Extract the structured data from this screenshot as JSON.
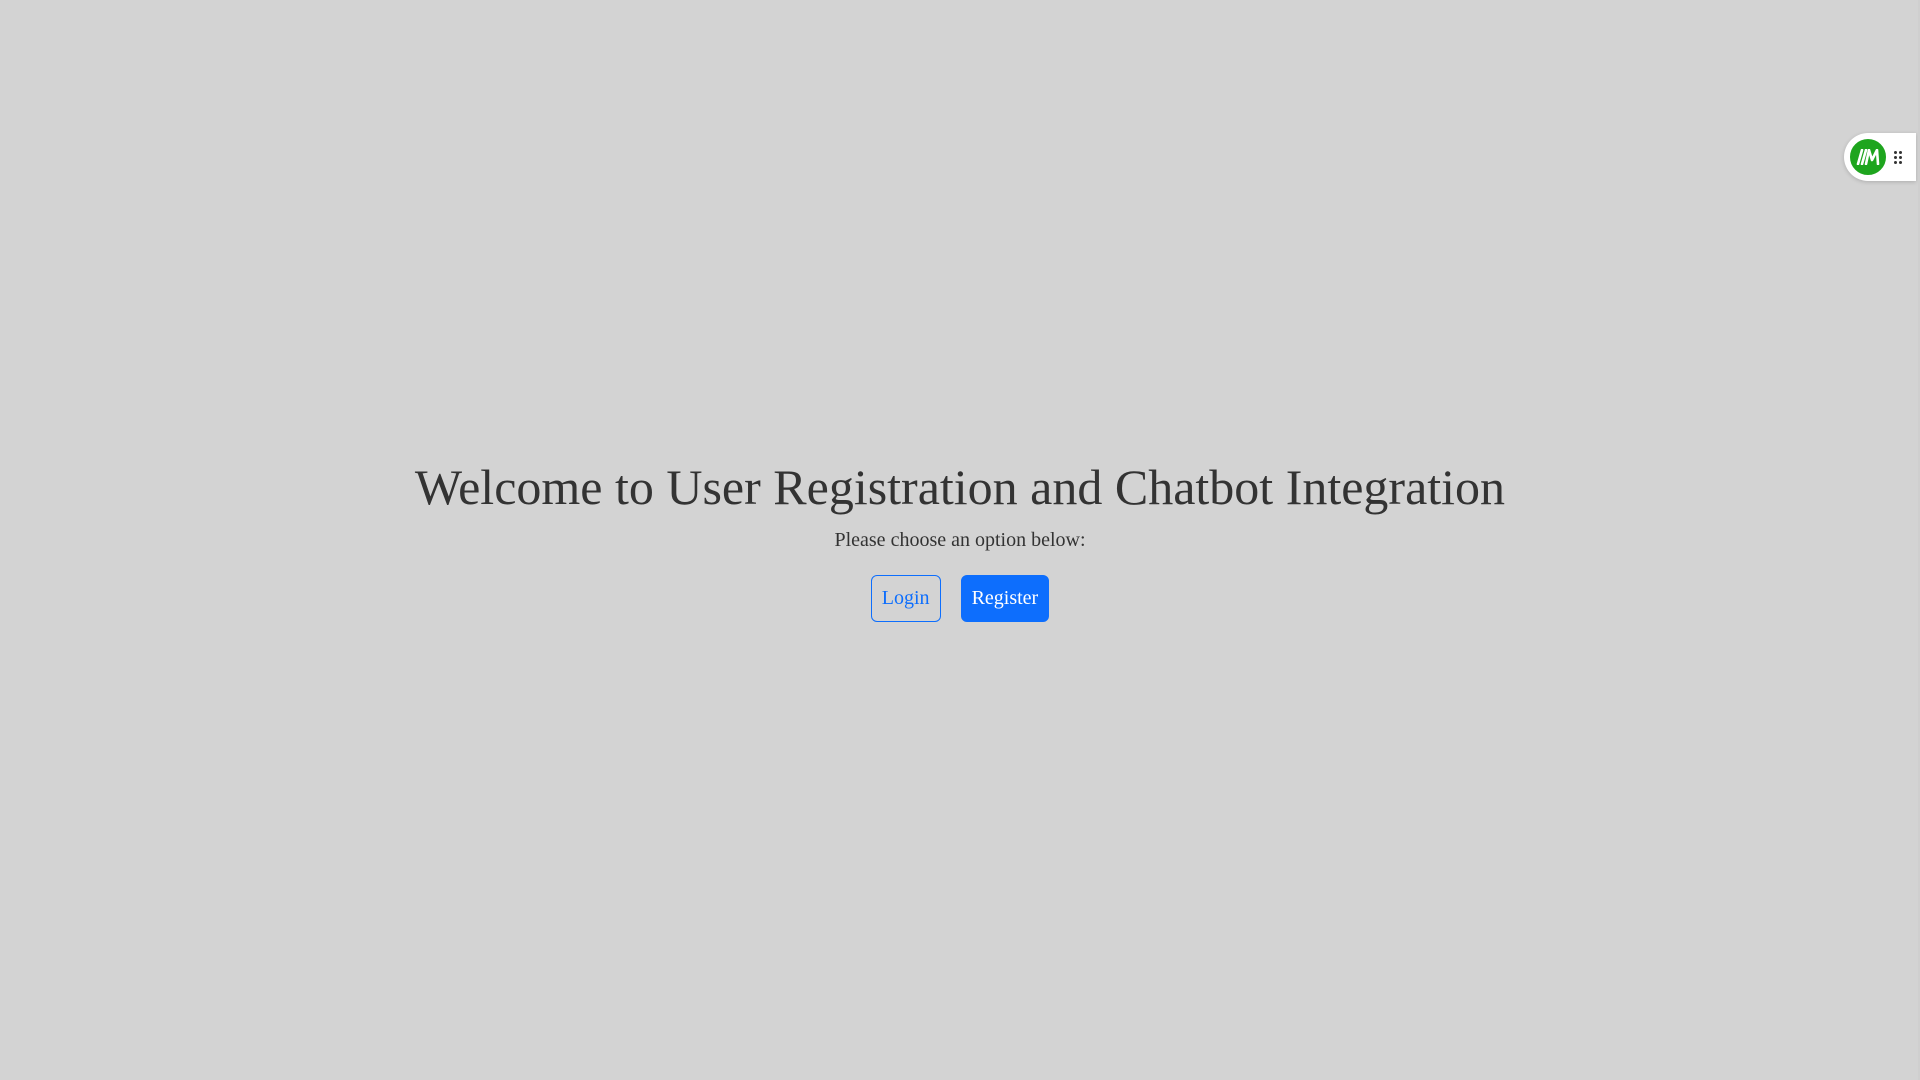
{
  "main": {
    "title": "Welcome to User Registration and Chatbot Integration",
    "subtitle": "Please choose an option below:",
    "login_label": "Login",
    "register_label": "Register"
  },
  "widget": {
    "logo_icon": "monica-logo-icon",
    "drag_icon": "drag-handle-icon",
    "accent_color": "#1ea51e"
  },
  "colors": {
    "background": "#d3d3d3",
    "primary": "#0d6efd",
    "text": "#333333"
  }
}
